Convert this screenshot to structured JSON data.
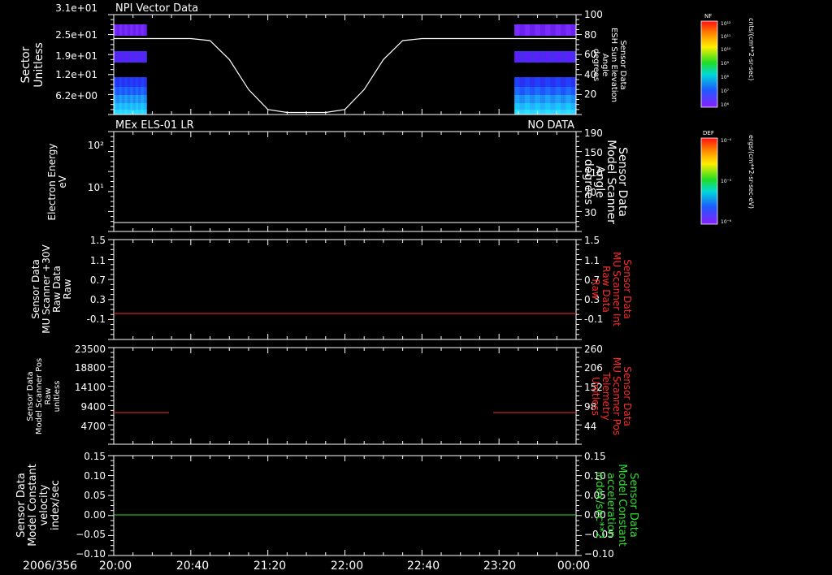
{
  "date_label": "2006/356",
  "time_ticks": [
    "20:00",
    "20:40",
    "21:20",
    "22:00",
    "22:40",
    "23:20",
    "00:00"
  ],
  "colors": {
    "axes": "#ffffff",
    "red": "#ff2a2a",
    "green": "#33dd33",
    "background": "#000000"
  },
  "chart_data": [
    {
      "type": "heatmap",
      "title": "NPI Vector Data",
      "ylabel_left": [
        "Sector",
        "Unitless"
      ],
      "left_ticks": [
        "3.1e+01",
        "2.5e+01",
        "1.9e+01",
        "1.2e+01",
        "6.2e+00"
      ],
      "ylabel_right": [
        "Sensor Data",
        "ESH Sun Elevation",
        "Angle",
        "degrees"
      ],
      "right_ticks": [
        "100",
        "80",
        "60",
        "40",
        "20"
      ],
      "right_ylim": [
        0,
        100
      ],
      "line_series": {
        "name": "ESH Sun Elevation",
        "x_minutes": [
          0,
          20,
          30,
          40,
          50,
          60,
          70,
          80,
          90,
          100,
          110,
          120,
          130,
          140,
          150,
          160,
          180,
          200,
          240
        ],
        "y": [
          76,
          76,
          76,
          76,
          74,
          55,
          25,
          5,
          2,
          2,
          2,
          5,
          25,
          55,
          74,
          76,
          76,
          76,
          76
        ]
      },
      "heat_time_blocks_minutes": [
        [
          0,
          17
        ],
        [
          208,
          240
        ]
      ]
    },
    {
      "type": "line",
      "title": "MEx ELS-01 LR",
      "status": "NO DATA",
      "ylabel_left": [
        "Electron Energy",
        "eV"
      ],
      "left_ticks": [
        "10²",
        "10¹"
      ],
      "ylabel_right": [
        "Sensor Data",
        "Model Scanner",
        "Angle",
        "degrees"
      ],
      "right_ticks": [
        "190",
        "150",
        "110",
        "70",
        "30"
      ],
      "right_ylim": [
        0,
        190
      ],
      "series": [
        {
          "x_minutes": [
            0,
            240
          ],
          "y": [
            10,
            10
          ]
        }
      ]
    },
    {
      "type": "line",
      "ylabel_left": [
        "Sensor Data",
        "MU Scanner +30V",
        "Raw Data",
        "Raw"
      ],
      "left_ticks": [
        "1.5",
        "1.1",
        "0.7",
        "0.3",
        "-0.1"
      ],
      "ylabel_right": [
        "Sensor Data",
        "MU Scanner Int",
        "Raw Data",
        "Raw"
      ],
      "right_ticks": [
        "1.5",
        "1.1",
        "0.7",
        "0.3",
        "-0.1"
      ],
      "ylim": [
        -0.3,
        1.5
      ],
      "series": [
        {
          "x_minutes": [
            0,
            240
          ],
          "y": [
            -0.03,
            -0.03
          ]
        }
      ]
    },
    {
      "type": "line",
      "ylabel_left": [
        "Sensor Data",
        "Model Scanner Pos",
        "Raw",
        "unitless"
      ],
      "left_ticks": [
        "23500",
        "18800",
        "14100",
        "9400",
        "4700"
      ],
      "ylabel_right": [
        "Sensor Data",
        "MU Scanner Pos",
        "Telemetry",
        "Unitless"
      ],
      "right_ticks": [
        "260",
        "206",
        "152",
        "98",
        "44"
      ],
      "ylim": [
        0,
        23500
      ],
      "series": [
        {
          "x_minutes": [
            0,
            22
          ],
          "y": [
            8000,
            8000
          ]
        },
        {
          "x_minutes": [
            202,
            240
          ],
          "y": [
            8000,
            8000
          ]
        }
      ]
    },
    {
      "type": "line",
      "ylabel_left": [
        "Sensor Data",
        "Model Constant",
        "velocity",
        "index/sec"
      ],
      "left_ticks": [
        "0.15",
        "0.10",
        "0.05",
        "0.00",
        "−0.05",
        "−0.10"
      ],
      "ylabel_right": [
        "Sensor Data",
        "Model Constant",
        "acceleration",
        "index/sec**2"
      ],
      "right_ticks": [
        "0.15",
        "0.10",
        "0.05",
        "0.00",
        "−0.05",
        "−0.10"
      ],
      "ylim": [
        -0.1,
        0.15
      ],
      "series": [
        {
          "x_minutes": [
            0,
            240
          ],
          "y": [
            0,
            0
          ]
        }
      ]
    }
  ],
  "colorbars": [
    {
      "label": "NF",
      "unit": "cnts/(cm**2-sr-sec)",
      "ticks": [
        "10¹²",
        "10¹¹",
        "10¹⁰",
        "10⁹",
        "10⁸",
        "10⁷",
        "10⁶"
      ]
    },
    {
      "label": "DEF",
      "unit": "ergs/(cm**2-sr-sec-eV)",
      "ticks": [
        "10⁻⁴",
        "10⁻⁵",
        "10⁻⁶"
      ]
    }
  ]
}
